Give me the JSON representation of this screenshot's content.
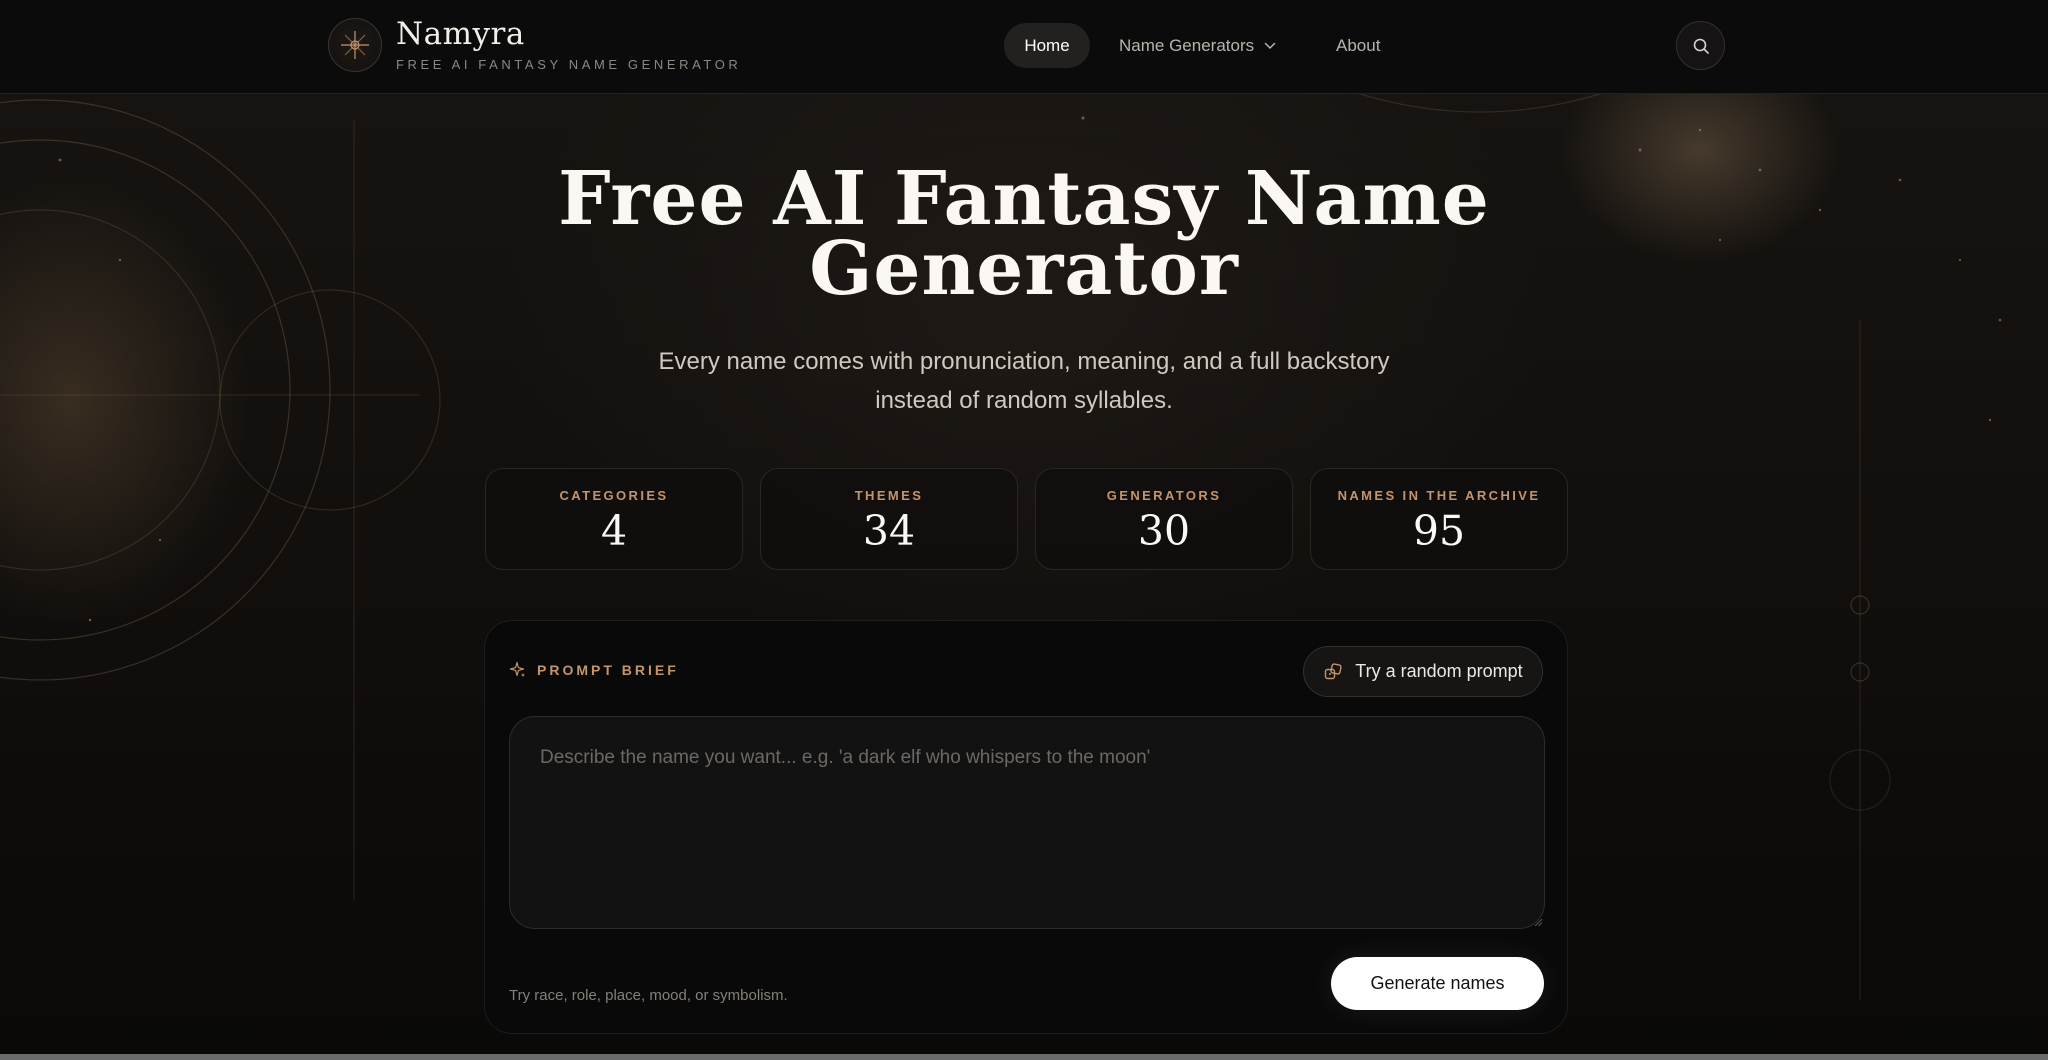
{
  "brand": {
    "name": "Namyra",
    "tagline": "FREE AI FANTASY NAME GENERATOR",
    "logo_icon": "compass-star-icon"
  },
  "nav": {
    "items": [
      {
        "label": "Home",
        "active": true
      },
      {
        "label": "Name Generators",
        "has_dropdown": true
      },
      {
        "label": "About"
      }
    ],
    "search_icon": "search-icon"
  },
  "hero": {
    "title": "Free AI Fantasy Name Generator",
    "subtitle": "Every name comes with pronunciation, meaning, and a full backstory instead of random syllables."
  },
  "stats": [
    {
      "label": "CATEGORIES",
      "value": "4"
    },
    {
      "label": "THEMES",
      "value": "34"
    },
    {
      "label": "GENERATORS",
      "value": "30"
    },
    {
      "label": "NAMES IN THE ARCHIVE",
      "value": "95"
    }
  ],
  "prompt": {
    "section_label": "PROMPT BRIEF",
    "section_icon": "sparkle-icon",
    "random_button": "Try a random prompt",
    "random_icon": "dice-icon",
    "placeholder": "Describe the name you want... e.g. 'a dark elf who whispers to the moon'",
    "value": "",
    "hint": "Try race, role, place, mood, or symbolism.",
    "generate_button": "Generate names"
  },
  "colors": {
    "accent": "#c4946a",
    "background": "#0b0a09",
    "primary_button": "#ffffff"
  }
}
